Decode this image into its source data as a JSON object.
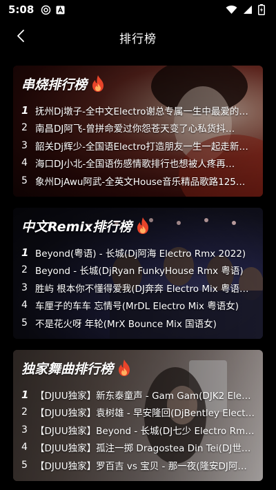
{
  "status": {
    "time": "5:08",
    "icons": [
      "radio-icon",
      "a-notification-icon",
      "wifi-icon",
      "signal-icon",
      "battery-icon"
    ]
  },
  "header": {
    "title": "排行榜",
    "back_icon": "chevron-left-icon"
  },
  "charts": [
    {
      "title": "串烧排行榜",
      "icon": "fire-icon",
      "items": [
        {
          "rank": "1",
          "text": "抚州Dj墩子-全中文Electro谢总专属一生中最爱的…"
        },
        {
          "rank": "2",
          "text": "南昌DJ阿飞-曾拼命爱过你怨苍天变了心私货抖…"
        },
        {
          "rank": "3",
          "text": "韶关Dj辉少-全国语Electro打造朋友一生一起走新…"
        },
        {
          "rank": "4",
          "text": "海口DJ小北-全国语伤感情歌排行也想被人疼再…"
        },
        {
          "rank": "5",
          "text": "象州DjAwu阿武-全英文House音乐精品歌路125…"
        }
      ]
    },
    {
      "title": "中文Remix排行榜",
      "icon": "fire-icon",
      "items": [
        {
          "rank": "1",
          "text": "Beyond(粤语) - 长城(Dj阿海 Electro Rmx 2022)"
        },
        {
          "rank": "2",
          "text": "Beyond - 长城(DjRyan FunkyHouse Rmx 粤语)"
        },
        {
          "rank": "3",
          "text": "胜屿 根本你不懂得爱我(DJ奔奔 Electro Mix 粤语…"
        },
        {
          "rank": "4",
          "text": "车厘子的车车 忘情号(MrDL Electro Mix 粤语女)"
        },
        {
          "rank": "5",
          "text": "不是花火呀 年轮(MrX Bounce Mix 国语女)"
        }
      ]
    },
    {
      "title": "独家舞曲排行榜",
      "icon": "fire-icon",
      "items": [
        {
          "rank": "1",
          "text": "【DJUU独家】新东泰童声 - Gam Gam(DJK2 Ele…"
        },
        {
          "rank": "2",
          "text": "【DJUU独家】袁树雄 - 早安隆回(DjBentley Elect…"
        },
        {
          "rank": "3",
          "text": "【DJUU独家】Beyond - 长城(DJ七少 Electro Rm…"
        },
        {
          "rank": "4",
          "text": "【DJUU独家】孤注一掷 Dragostea Din Tei(DJ世…"
        },
        {
          "rank": "5",
          "text": "【DJUU独家】罗百吉 vs 宝贝 - 那一夜(隆安DJ阿…"
        }
      ]
    }
  ],
  "colors": {
    "background": "#000000",
    "fire": "#e8442a",
    "fire_inner": "#ffb060",
    "text": "#ffffff"
  }
}
